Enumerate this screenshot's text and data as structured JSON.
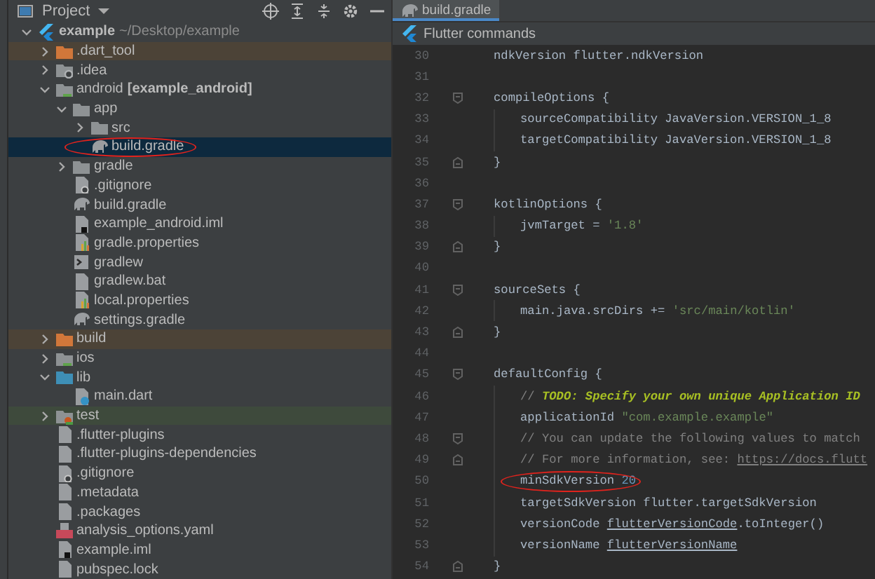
{
  "project_panel": {
    "title": "Project"
  },
  "tree": [
    {
      "label": "example",
      "detail": "~/Desktop/example",
      "kind": "project",
      "selected": false,
      "circled": false,
      "expanded": true,
      "children": [
        {
          "label": ".dart_tool",
          "kind": "excluded",
          "selected": false,
          "circled": false,
          "expanded": false
        },
        {
          "label": ".idea",
          "kind": "config",
          "selected": false,
          "circled": false,
          "expanded": false
        },
        {
          "label": "android",
          "detail": "[example_android]",
          "kind": "module",
          "selected": false,
          "circled": false,
          "expanded": true,
          "children": [
            {
              "label": "app",
              "kind": "folder",
              "selected": false,
              "circled": false,
              "expanded": true,
              "children": [
                {
                  "label": "src",
                  "kind": "folder",
                  "selected": false,
                  "circled": false,
                  "expanded": false
                },
                {
                  "label": "build.gradle",
                  "kind": "gradle",
                  "selected": true,
                  "circled": true
                }
              ]
            },
            {
              "label": "gradle",
              "kind": "folder",
              "selected": false,
              "circled": false,
              "expanded": false
            },
            {
              "label": ".gitignore",
              "kind": "ignore",
              "selected": false,
              "circled": false
            },
            {
              "label": "build.gradle",
              "kind": "gradle",
              "selected": false,
              "circled": false
            },
            {
              "label": "example_android.iml",
              "kind": "iml",
              "selected": false,
              "circled": false
            },
            {
              "label": "gradle.properties",
              "kind": "properties",
              "selected": false,
              "circled": false
            },
            {
              "label": "gradlew",
              "kind": "script",
              "selected": false,
              "circled": false
            },
            {
              "label": "gradlew.bat",
              "kind": "file",
              "selected": false,
              "circled": false
            },
            {
              "label": "local.properties",
              "kind": "properties",
              "selected": false,
              "circled": false
            },
            {
              "label": "settings.gradle",
              "kind": "gradle",
              "selected": false,
              "circled": false
            }
          ]
        },
        {
          "label": "build",
          "kind": "excluded",
          "selected": false,
          "circled": false,
          "expanded": false
        },
        {
          "label": "ios",
          "kind": "module",
          "selected": false,
          "circled": false,
          "expanded": false
        },
        {
          "label": "lib",
          "kind": "source",
          "selected": false,
          "circled": false,
          "expanded": true,
          "children": [
            {
              "label": "main.dart",
              "kind": "dart",
              "selected": false,
              "circled": false
            }
          ]
        },
        {
          "label": "test",
          "kind": "test",
          "selected": false,
          "circled": false,
          "expanded": false
        },
        {
          "label": ".flutter-plugins",
          "kind": "file",
          "selected": false,
          "circled": false
        },
        {
          "label": ".flutter-plugins-dependencies",
          "kind": "file",
          "selected": false,
          "circled": false
        },
        {
          "label": ".gitignore",
          "kind": "ignore",
          "selected": false,
          "circled": false
        },
        {
          "label": ".metadata",
          "kind": "file",
          "selected": false,
          "circled": false
        },
        {
          "label": ".packages",
          "kind": "file",
          "selected": false,
          "circled": false
        },
        {
          "label": "analysis_options.yaml",
          "kind": "yaml",
          "selected": false,
          "circled": false
        },
        {
          "label": "example.iml",
          "kind": "iml",
          "selected": false,
          "circled": false
        },
        {
          "label": "pubspec.lock",
          "kind": "file",
          "selected": false,
          "circled": false
        }
      ]
    }
  ],
  "tabs": [
    {
      "label": "build.gradle",
      "selected": true
    }
  ],
  "toolbar": {
    "label": "Flutter commands"
  },
  "code": [
    {
      "number": "30",
      "nested": false,
      "fold_start": false,
      "fold_end": false,
      "circled": false,
      "tokens": [
        {
          "kind": "plain",
          "text": "ndkVersion flutter.ndkVersion"
        }
      ]
    },
    {
      "number": "31",
      "nested": false,
      "fold_start": false,
      "fold_end": false,
      "circled": false
    },
    {
      "number": "32",
      "nested": false,
      "fold_start": true,
      "fold_end": false,
      "circled": false,
      "tokens": [
        {
          "kind": "plain",
          "text": "compileOptions {"
        }
      ]
    },
    {
      "number": "33",
      "nested": true,
      "fold_start": false,
      "fold_end": false,
      "circled": false,
      "tokens": [
        {
          "kind": "plain",
          "text": "sourceCompatibility JavaVersion.VERSION_1_8"
        }
      ]
    },
    {
      "number": "34",
      "nested": true,
      "fold_start": false,
      "fold_end": false,
      "circled": false,
      "tokens": [
        {
          "kind": "plain",
          "text": "targetCompatibility JavaVersion.VERSION_1_8"
        }
      ]
    },
    {
      "number": "35",
      "nested": false,
      "fold_start": false,
      "fold_end": true,
      "circled": false,
      "tokens": [
        {
          "kind": "plain",
          "text": "}"
        }
      ]
    },
    {
      "number": "36",
      "nested": false,
      "fold_start": false,
      "fold_end": false,
      "circled": false
    },
    {
      "number": "37",
      "nested": false,
      "fold_start": true,
      "fold_end": false,
      "circled": false,
      "tokens": [
        {
          "kind": "plain",
          "text": "kotlinOptions {"
        }
      ]
    },
    {
      "number": "38",
      "nested": true,
      "fold_start": false,
      "fold_end": false,
      "circled": false,
      "tokens": [
        {
          "kind": "plain",
          "text": "jvmTarget = "
        },
        {
          "kind": "string",
          "text": "'1.8'"
        }
      ]
    },
    {
      "number": "39",
      "nested": false,
      "fold_start": false,
      "fold_end": true,
      "circled": false,
      "tokens": [
        {
          "kind": "plain",
          "text": "}"
        }
      ]
    },
    {
      "number": "40",
      "nested": false,
      "fold_start": false,
      "fold_end": false,
      "circled": false
    },
    {
      "number": "41",
      "nested": false,
      "fold_start": true,
      "fold_end": false,
      "circled": false,
      "tokens": [
        {
          "kind": "plain",
          "text": "sourceSets {"
        }
      ]
    },
    {
      "number": "42",
      "nested": true,
      "fold_start": false,
      "fold_end": false,
      "circled": false,
      "tokens": [
        {
          "kind": "plain",
          "text": "main.java.srcDirs += "
        },
        {
          "kind": "string",
          "text": "'src/main/kotlin'"
        }
      ]
    },
    {
      "number": "43",
      "nested": false,
      "fold_start": false,
      "fold_end": true,
      "circled": false,
      "tokens": [
        {
          "kind": "plain",
          "text": "}"
        }
      ]
    },
    {
      "number": "44",
      "nested": false,
      "fold_start": false,
      "fold_end": false,
      "circled": false
    },
    {
      "number": "45",
      "nested": false,
      "fold_start": true,
      "fold_end": false,
      "circled": false,
      "tokens": [
        {
          "kind": "plain",
          "text": "defaultConfig {"
        }
      ]
    },
    {
      "number": "46",
      "nested": true,
      "fold_start": false,
      "fold_end": false,
      "circled": false,
      "tokens": [
        {
          "kind": "comment",
          "text": "// "
        },
        {
          "kind": "todo",
          "text": "TODO: Specify your own unique Application ID"
        }
      ]
    },
    {
      "number": "47",
      "nested": true,
      "fold_start": false,
      "fold_end": false,
      "circled": false,
      "tokens": [
        {
          "kind": "plain",
          "text": "applicationId "
        },
        {
          "kind": "string",
          "text": "\"com.example.example\""
        }
      ]
    },
    {
      "number": "48",
      "nested": true,
      "fold_start": true,
      "fold_end": false,
      "circled": false,
      "tokens": [
        {
          "kind": "comment",
          "text": "// You can update the following values to match"
        }
      ]
    },
    {
      "number": "49",
      "nested": true,
      "fold_start": false,
      "fold_end": true,
      "circled": false,
      "tokens": [
        {
          "kind": "comment",
          "text": "// For more information, see: "
        },
        {
          "kind": "link",
          "text": "https://docs.flutt"
        }
      ]
    },
    {
      "number": "50",
      "nested": true,
      "fold_start": false,
      "fold_end": false,
      "circled": true,
      "tokens": [
        {
          "kind": "plain",
          "text": "minSdkVersion "
        },
        {
          "kind": "number",
          "text": "20"
        }
      ]
    },
    {
      "number": "51",
      "nested": true,
      "fold_start": false,
      "fold_end": false,
      "circled": false,
      "tokens": [
        {
          "kind": "plain",
          "text": "targetSdkVersion flutter.targetSdkVersion"
        }
      ]
    },
    {
      "number": "52",
      "nested": true,
      "fold_start": false,
      "fold_end": false,
      "circled": false,
      "tokens": [
        {
          "kind": "plain",
          "text": "versionCode "
        },
        {
          "kind": "underlined",
          "text": "flutterVersionCode"
        },
        {
          "kind": "plain",
          "text": ".toInteger()"
        }
      ]
    },
    {
      "number": "53",
      "nested": true,
      "fold_start": false,
      "fold_end": false,
      "circled": false,
      "tokens": [
        {
          "kind": "plain",
          "text": "versionName "
        },
        {
          "kind": "underlined",
          "text": "flutterVersionName"
        }
      ]
    },
    {
      "number": "54",
      "nested": false,
      "fold_start": false,
      "fold_end": true,
      "circled": false,
      "tokens": [
        {
          "kind": "plain",
          "text": "}"
        }
      ]
    }
  ]
}
